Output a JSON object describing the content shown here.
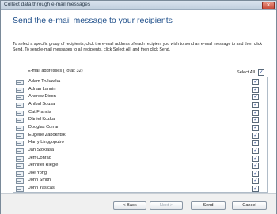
{
  "window": {
    "title": "Collect data through e-mail messages",
    "close_glyph": "✕"
  },
  "main": {
    "heading": "Send the e-mail message to your recipients",
    "instructions": "To select a specific group of recipients, click the e-mail address of each recipient you wish to send an e-mail message to and then click Send. To send e-mail messages to all recipients, click Select All, and then click Send.",
    "list_header": "E-mail addresses (Total: 32)",
    "select_all_label": "Select All",
    "select_all_checked": "✓",
    "check_glyph": "✓",
    "recipients": [
      {
        "name": "Adam Trukawka"
      },
      {
        "name": "Adrian Lannin"
      },
      {
        "name": "Andrew Dixon"
      },
      {
        "name": "Aníbal Sousa"
      },
      {
        "name": "Cat Francis"
      },
      {
        "name": "Dániel Kozka"
      },
      {
        "name": "Douglas Curran"
      },
      {
        "name": "Eugene Zabokritski"
      },
      {
        "name": "Harry Linggoputro"
      },
      {
        "name": "Jan Stoklasa"
      },
      {
        "name": "Jeff Conrad"
      },
      {
        "name": "Jennifer Riegle"
      },
      {
        "name": "Joe Yong"
      },
      {
        "name": "John Smith"
      },
      {
        "name": "John Yasicas"
      }
    ]
  },
  "footer": {
    "back_label": "< Back",
    "next_label": "Next >",
    "send_label": "Send",
    "cancel_label": "Cancel"
  }
}
